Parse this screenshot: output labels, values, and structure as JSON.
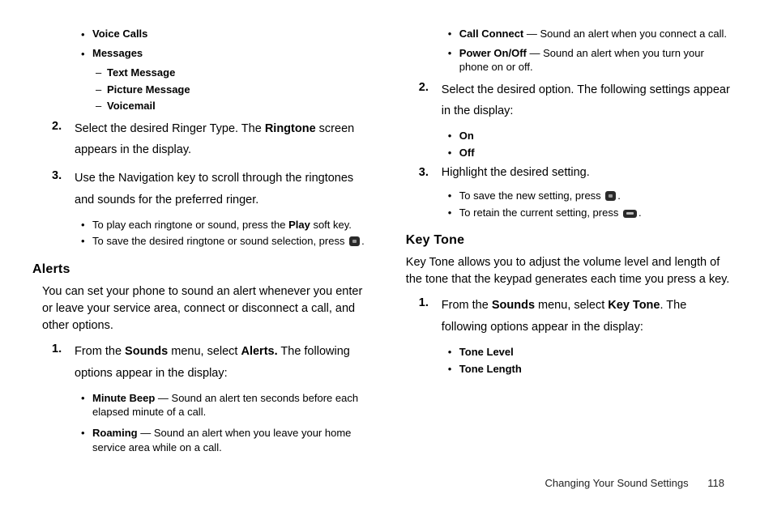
{
  "left": {
    "bullets_top": [
      "Voice Calls",
      "Messages"
    ],
    "dashes": [
      "Text Message",
      "Picture Message",
      "Voicemail"
    ],
    "step2_a": "Select the desired Ringer Type. The ",
    "step2_bold": "Ringtone",
    "step2_b": " screen appears in the display.",
    "step3": "Use the Navigation key to scroll through the ringtones and sounds for the preferred ringer.",
    "sub_a_pre": "To play each ringtone or sound, press the ",
    "sub_a_bold": "Play",
    "sub_a_post": " soft key.",
    "sub_b": "To save the desired ringtone or sound selection, press ",
    "alerts_head": "Alerts",
    "alerts_para": "You can set your phone to sound an alert whenever you enter or leave your service area, connect or disconnect a call, and other options.",
    "a1_a": "From the ",
    "a1_b1": "Sounds",
    "a1_mid": " menu, select ",
    "a1_b2": "Alerts.",
    "a1_c": " The following options appear in the display:",
    "a_items": [
      {
        "label": "Minute Beep",
        "desc": " — Sound an alert ten seconds before each elapsed minute of a call."
      },
      {
        "label": "Roaming",
        "desc": " — Sound an alert when you leave your home service area while on a call."
      }
    ]
  },
  "right": {
    "r_items": [
      {
        "label": "Call Connect",
        "desc": " — Sound an alert when you connect a call."
      },
      {
        "label": "Power On/Off",
        "desc": " — Sound an alert when you turn your phone on or off."
      }
    ],
    "step2": "Select the desired option. The following settings appear in the display:",
    "onoff": [
      "On",
      "Off"
    ],
    "step3": "Highlight the desired setting.",
    "sub_save": "To save the new setting, press ",
    "sub_retain": "To retain the current setting, press ",
    "keytone_head": "Key Tone",
    "keytone_para": "Key Tone allows you to adjust the volume level and length of the tone that the keypad generates each time you press a key.",
    "k1_a": "From the ",
    "k1_b1": "Sounds",
    "k1_mid": " menu, select ",
    "k1_b2": "Key Tone",
    "k1_c": ". The following options appear in the display:",
    "k_items": [
      "Tone Level",
      "Tone Length"
    ]
  },
  "footer": {
    "title": "Changing Your Sound Settings",
    "page": "118"
  },
  "numbers": {
    "n1": "1.",
    "n2": "2.",
    "n3": "3."
  },
  "period": "."
}
